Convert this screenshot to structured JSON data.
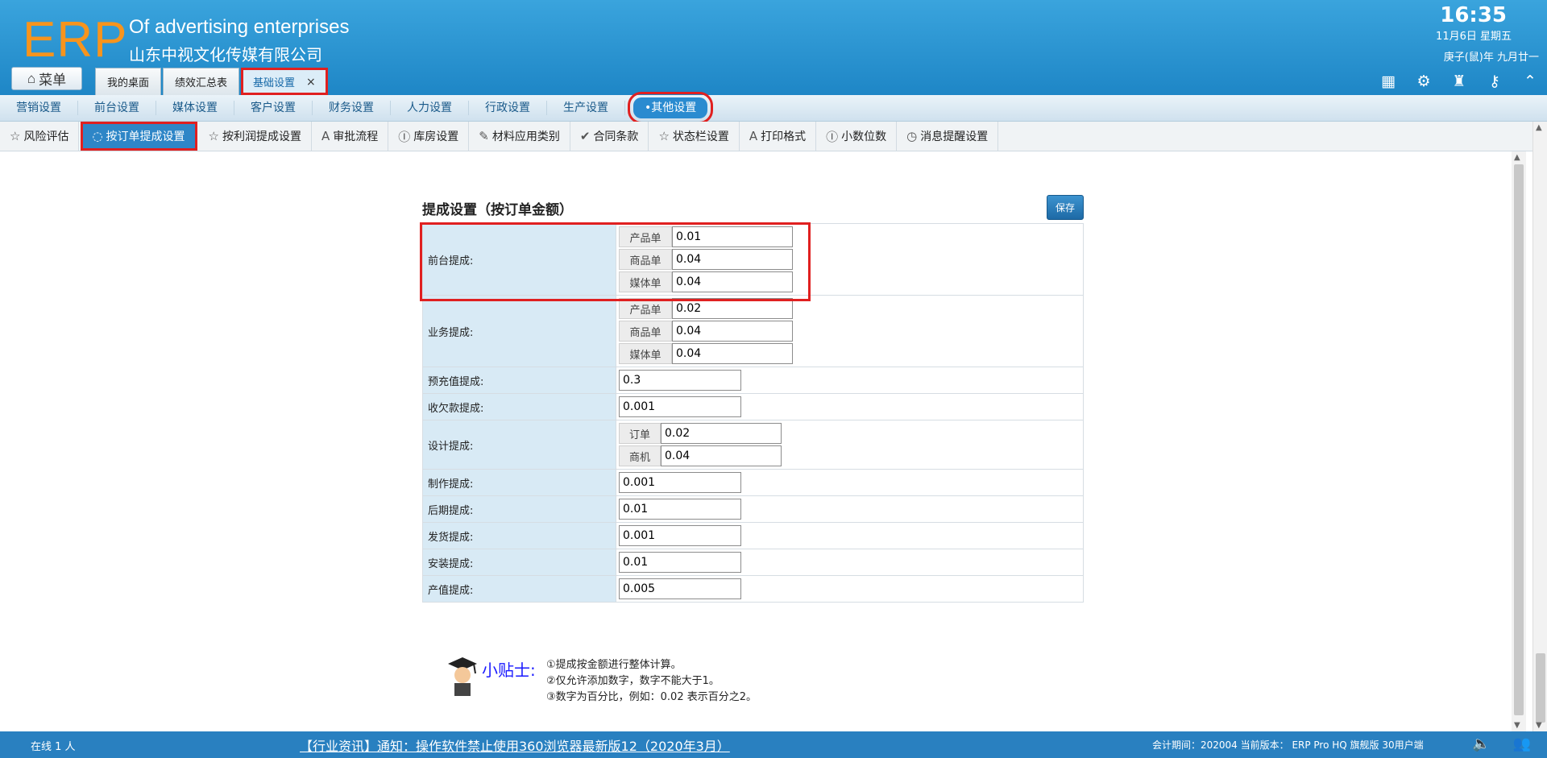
{
  "header": {
    "logo": "ERP",
    "company_en": "Of advertising enterprises",
    "company_cn": "山东中视文化传媒有限公司",
    "menu_label": "菜单",
    "time": "16:35",
    "date": "11月6日 星期五",
    "lunar": "庚子(鼠)年 九月廿一",
    "icons": [
      "grid-add-icon",
      "gear-icon",
      "shirt-icon",
      "key-icon",
      "up-circle-icon"
    ]
  },
  "top_tabs": [
    {
      "label": "我的桌面"
    },
    {
      "label": "绩效汇总表"
    },
    {
      "label": "基础设置",
      "close": "×"
    }
  ],
  "nav1": [
    "营销设置",
    "前台设置",
    "媒体设置",
    "客户设置",
    "财务设置",
    "人力设置",
    "行政设置",
    "生产设置",
    "•其他设置"
  ],
  "nav2": [
    {
      "icon": "☆",
      "label": "风险评估"
    },
    {
      "icon": "◌",
      "label": "按订单提成设置"
    },
    {
      "icon": "☆",
      "label": "按利润提成设置"
    },
    {
      "icon": "A",
      "label": "审批流程"
    },
    {
      "icon": "Ⓘ",
      "label": "库房设置"
    },
    {
      "icon": "✎",
      "label": "材料应用类别"
    },
    {
      "icon": "✔",
      "label": "合同条款"
    },
    {
      "icon": "☆",
      "label": "状态栏设置"
    },
    {
      "icon": "A",
      "label": "打印格式"
    },
    {
      "icon": "Ⓘ",
      "label": "小数位数"
    },
    {
      "icon": "◷",
      "label": "消息提醒设置"
    }
  ],
  "panel": {
    "title": "提成设置（按订单金额）",
    "save": "保存",
    "rows": [
      {
        "label": "前台提成:",
        "pairs": [
          [
            "产品单",
            "0.01"
          ],
          [
            "商品单",
            "0.04"
          ],
          [
            "媒体单",
            "0.04"
          ]
        ]
      },
      {
        "label": "业务提成:",
        "pairs": [
          [
            "产品单",
            "0.02"
          ],
          [
            "商品单",
            "0.04"
          ],
          [
            "媒体单",
            "0.04"
          ]
        ]
      },
      {
        "label": "预充值提成:",
        "value": "0.3"
      },
      {
        "label": "收欠款提成:",
        "value": "0.001"
      },
      {
        "label": "设计提成:",
        "pairs": [
          [
            "订单",
            "0.02"
          ],
          [
            "商机",
            "0.04"
          ]
        ]
      },
      {
        "label": "制作提成:",
        "value": "0.001"
      },
      {
        "label": "后期提成:",
        "value": "0.01"
      },
      {
        "label": "发货提成:",
        "value": "0.001"
      },
      {
        "label": "安装提成:",
        "value": "0.01"
      },
      {
        "label": "产值提成:",
        "value": "0.005"
      }
    ]
  },
  "tips": {
    "title": "小贴士:",
    "lines": [
      "①提成按金额进行整体计算。",
      "②仅允许添加数字，数字不能大于1。",
      "③数字为百分比，例如：0.02 表示百分之2。"
    ]
  },
  "footer": {
    "online": "在线  1  人",
    "news": "【行业资讯】通知：操作软件禁止使用360浏览器最新版12（2020年3月）",
    "account": "会计期间：202004 当前版本： ERP Pro HQ 旗舰版 30用户端"
  }
}
